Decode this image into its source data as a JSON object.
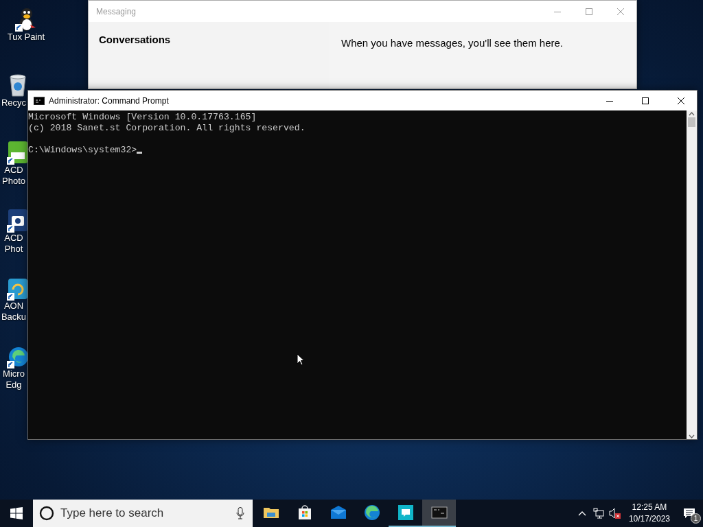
{
  "desktop_icons": [
    {
      "kind": "tux",
      "label_lines": [
        "Tux Paint"
      ],
      "shortcut": true
    },
    {
      "kind": "recycle-bin",
      "label_lines": [
        "Recyc"
      ],
      "shortcut": false
    },
    {
      "kind": "green-app",
      "label_lines": [
        "ACD",
        "Photo"
      ],
      "shortcut": true
    },
    {
      "kind": "camera-app",
      "label_lines": [
        "ACD",
        "Phot"
      ],
      "shortcut": true
    },
    {
      "kind": "backup-app",
      "label_lines": [
        "AON",
        "Backu"
      ],
      "shortcut": true
    },
    {
      "kind": "edge",
      "label_lines": [
        "Micro",
        "Edg"
      ],
      "shortcut": true
    }
  ],
  "messaging_window": {
    "title": "Messaging",
    "heading": "Conversations",
    "empty_message": "When you have messages, you'll see them here."
  },
  "command_window": {
    "title": "Administrator: Command Prompt",
    "lines": [
      "Microsoft Windows [Version 10.0.17763.165]",
      "(c) 2018 Sanet.st Corporation. All rights reserved."
    ],
    "prompt": "C:\\Windows\\system32>"
  },
  "taskbar": {
    "search": {
      "placeholder": "Type here to search"
    },
    "apps": [
      {
        "kind": "file-explorer",
        "running": false,
        "active": false
      },
      {
        "kind": "store",
        "running": false,
        "active": false
      },
      {
        "kind": "mail",
        "running": false,
        "active": false
      },
      {
        "kind": "edge",
        "running": false,
        "active": false
      },
      {
        "kind": "messaging",
        "running": true,
        "active": false
      },
      {
        "kind": "command-prompt",
        "running": true,
        "active": true
      }
    ],
    "clock": {
      "time": "12:25 AM",
      "date": "10/17/2023"
    },
    "notifications": {
      "count": "1"
    }
  }
}
